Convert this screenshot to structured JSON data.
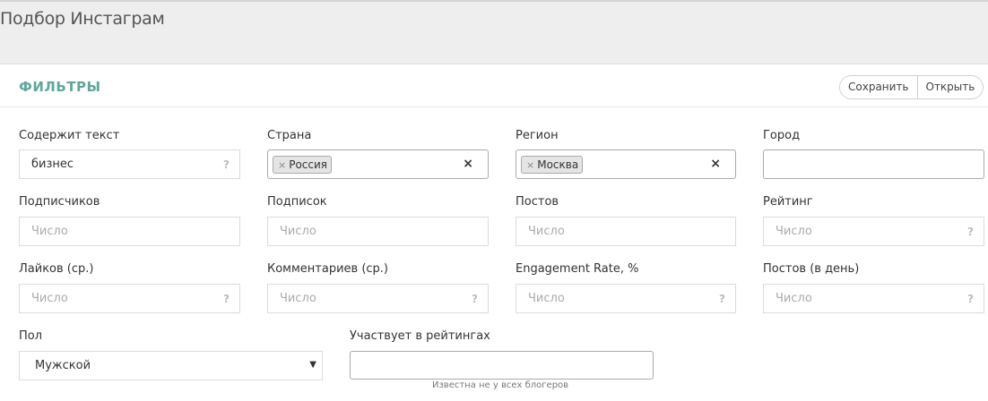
{
  "page": {
    "title": "Подбор Инстаграм"
  },
  "panel": {
    "title": "ФИЛЬТРЫ",
    "save_label": "Сохранить",
    "open_label": "Открыть"
  },
  "filters": {
    "contains_text": {
      "label": "Содержит текст",
      "value": "бизнес",
      "help": "?"
    },
    "country": {
      "label": "Страна",
      "tag": "Россия",
      "tag_remove": "×",
      "clear": "×"
    },
    "region": {
      "label": "Регион",
      "tag": "Москва",
      "tag_remove": "×",
      "clear": "×"
    },
    "city": {
      "label": "Город",
      "value": ""
    },
    "followers": {
      "label": "Подписчиков",
      "placeholder": "Число"
    },
    "following": {
      "label": "Подписок",
      "placeholder": "Число"
    },
    "posts": {
      "label": "Постов",
      "placeholder": "Число"
    },
    "rating": {
      "label": "Рейтинг",
      "placeholder": "Число",
      "help": "?"
    },
    "likes_avg": {
      "label": "Лайков (ср.)",
      "placeholder": "Число",
      "help": "?"
    },
    "comments_avg": {
      "label": "Комментариев (ср.)",
      "placeholder": "Число",
      "help": "?"
    },
    "engagement": {
      "label": "Engagement Rate, %",
      "placeholder": "Число",
      "help": "?"
    },
    "posts_per_day": {
      "label": "Постов (в день)",
      "placeholder": "Число",
      "help": "?"
    },
    "gender": {
      "label": "Пол",
      "value": "Мужской",
      "arrow": "▼"
    },
    "in_ratings": {
      "label": "Участвует в рейтингах",
      "value": "",
      "hint": "Известна не у всех блогеров"
    }
  },
  "colors": {
    "accent": "#5fa89a",
    "background": "#eeeeee"
  }
}
